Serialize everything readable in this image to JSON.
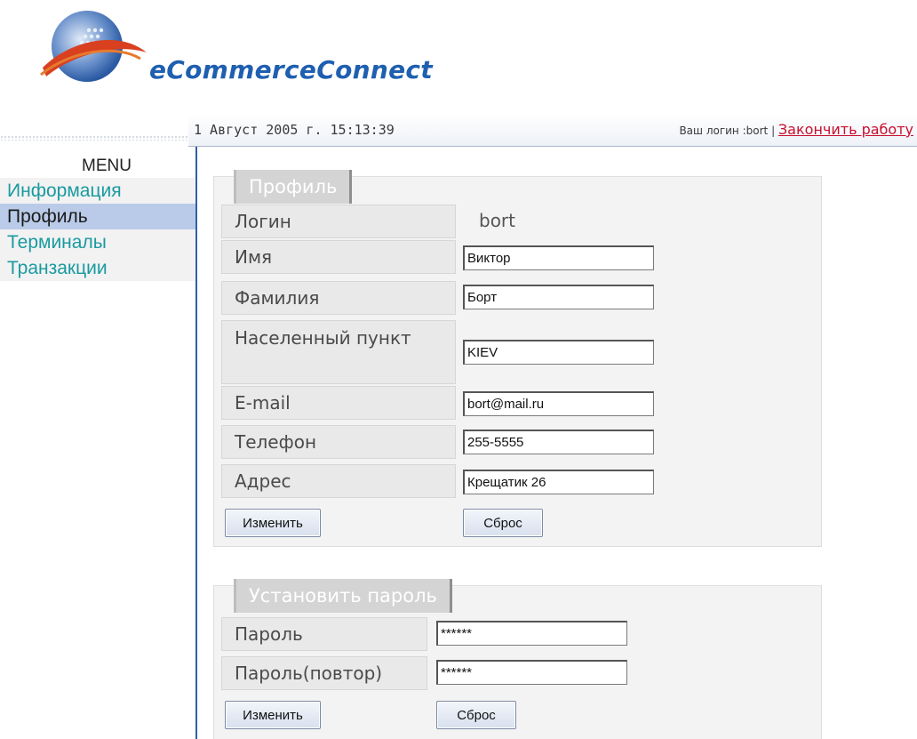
{
  "brand": {
    "name_part1": "eCommerce",
    "name_part2": "Connect"
  },
  "topbar": {
    "datetime": "1 Август 2005 г. 15:13:39",
    "login_prefix": "Ваш логин :",
    "login_user": "bort",
    "separator": " | ",
    "logout_label": "Закончить работу"
  },
  "menu": {
    "title": "MENU",
    "items": [
      {
        "label": "Информация",
        "active": false
      },
      {
        "label": "Профиль",
        "active": true
      },
      {
        "label": "Терминалы",
        "active": false
      },
      {
        "label": "Транзакции",
        "active": false
      }
    ]
  },
  "profile": {
    "title": "Профиль",
    "login_label": "Логин",
    "login_value": "bort",
    "fields": [
      {
        "label": "Имя",
        "value": "Виктор"
      },
      {
        "label": "Фамилия",
        "value": "Борт"
      },
      {
        "label": "Населенный пункт",
        "value": "KIEV"
      },
      {
        "label": "E-mail",
        "value": "bort@mail.ru"
      },
      {
        "label": "Телефон",
        "value": "255-5555"
      },
      {
        "label": "Адрес",
        "value": "Крещатик 26"
      }
    ],
    "change_button": "Изменить",
    "reset_button": "Сброс"
  },
  "password": {
    "title": "Установить пароль",
    "fields": [
      {
        "label": "Пароль",
        "value": "******"
      },
      {
        "label": "Пароль(повтор)",
        "value": "******"
      }
    ],
    "change_button": "Изменить",
    "reset_button": "Сброс"
  },
  "colors": {
    "accent_blue": "#2f5fa8",
    "menu_link": "#1a9aa0",
    "active_menu_bg": "#b9cbe8",
    "logout_red": "#c8102e"
  }
}
